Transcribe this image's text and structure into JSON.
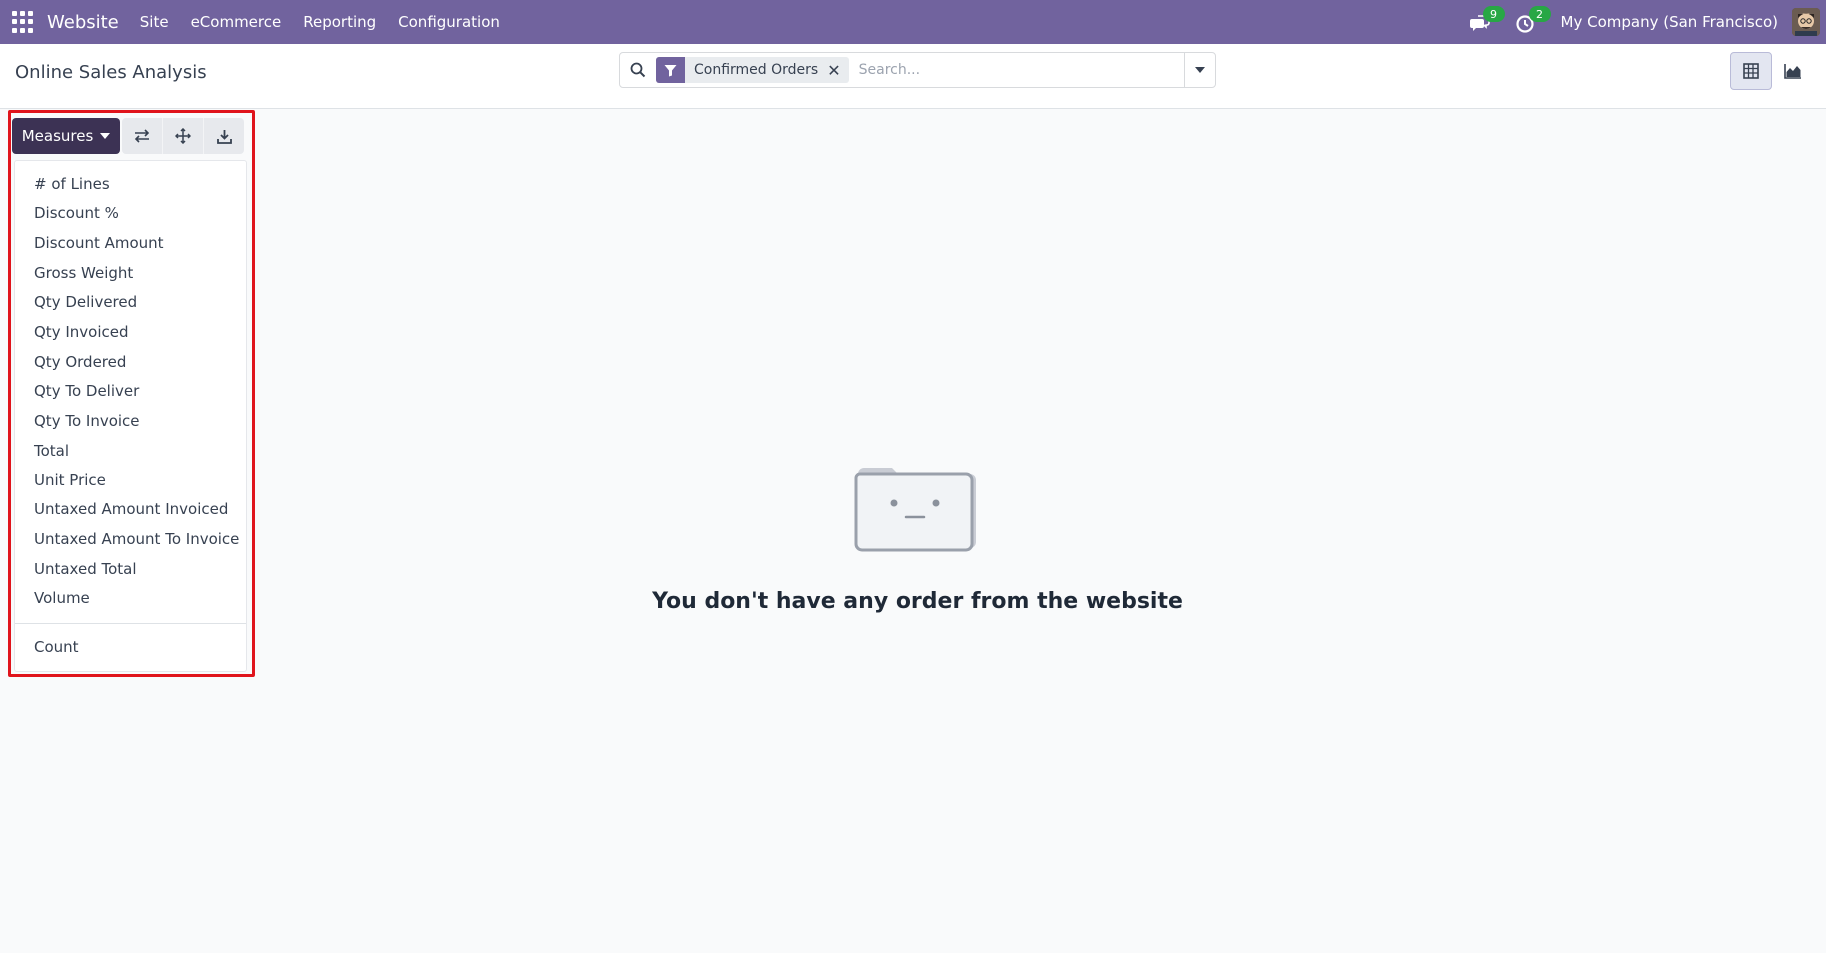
{
  "navbar": {
    "app_name": "Website",
    "menu": [
      "Site",
      "eCommerce",
      "Reporting",
      "Configuration"
    ],
    "messages_count": "9",
    "activities_count": "2",
    "company": "My Company (San Francisco)",
    "icons": [
      "apps-grid-icon",
      "chat-icon",
      "clock-icon",
      "avatar"
    ]
  },
  "control_panel": {
    "title": "Online Sales Analysis",
    "search": {
      "facet_label": "Confirmed Orders",
      "facet_remove": "✕",
      "placeholder": "Search..."
    },
    "views": [
      "pivot-view-icon",
      "graph-view-icon"
    ]
  },
  "toolbar": {
    "measures_label": "Measures",
    "icons": [
      "swap-axis-icon",
      "expand-all-icon",
      "download-icon"
    ]
  },
  "measures_menu": {
    "items": [
      "# of Lines",
      "Discount %",
      "Discount Amount",
      "Gross Weight",
      "Qty Delivered",
      "Qty Invoiced",
      "Qty Ordered",
      "Qty To Deliver",
      "Qty To Invoice",
      "Total",
      "Unit Price",
      "Untaxed Amount Invoiced",
      "Untaxed Amount To Invoice",
      "Untaxed Total",
      "Volume"
    ],
    "count_label": "Count"
  },
  "empty_state": {
    "message": "You don't have any order from the website"
  },
  "colors": {
    "navbar": "#71639e",
    "measures_button": "#3c3254",
    "highlight": "#e0141c",
    "badge": "#28a745"
  }
}
